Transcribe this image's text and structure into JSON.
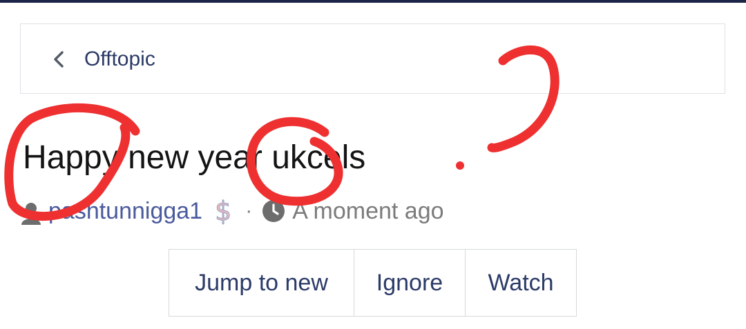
{
  "breadcrumb": {
    "back_icon": "chevron-left-icon",
    "label": "Offtopic"
  },
  "thread": {
    "title": "Happy new year ukcels",
    "author": "pashtunnigga1",
    "author_badge_icon": "dollar-icon",
    "separator": "·",
    "time_icon": "clock-icon",
    "time": "A moment ago"
  },
  "actions": {
    "jump_label": "Jump to new",
    "ignore_label": "Ignore",
    "watch_label": "Watch"
  },
  "colors": {
    "accent": "#2b3a67",
    "link": "#4a5a9c",
    "muted": "#7b7b7b",
    "annotation": "#ee3030",
    "top_bar": "#1c2447"
  }
}
